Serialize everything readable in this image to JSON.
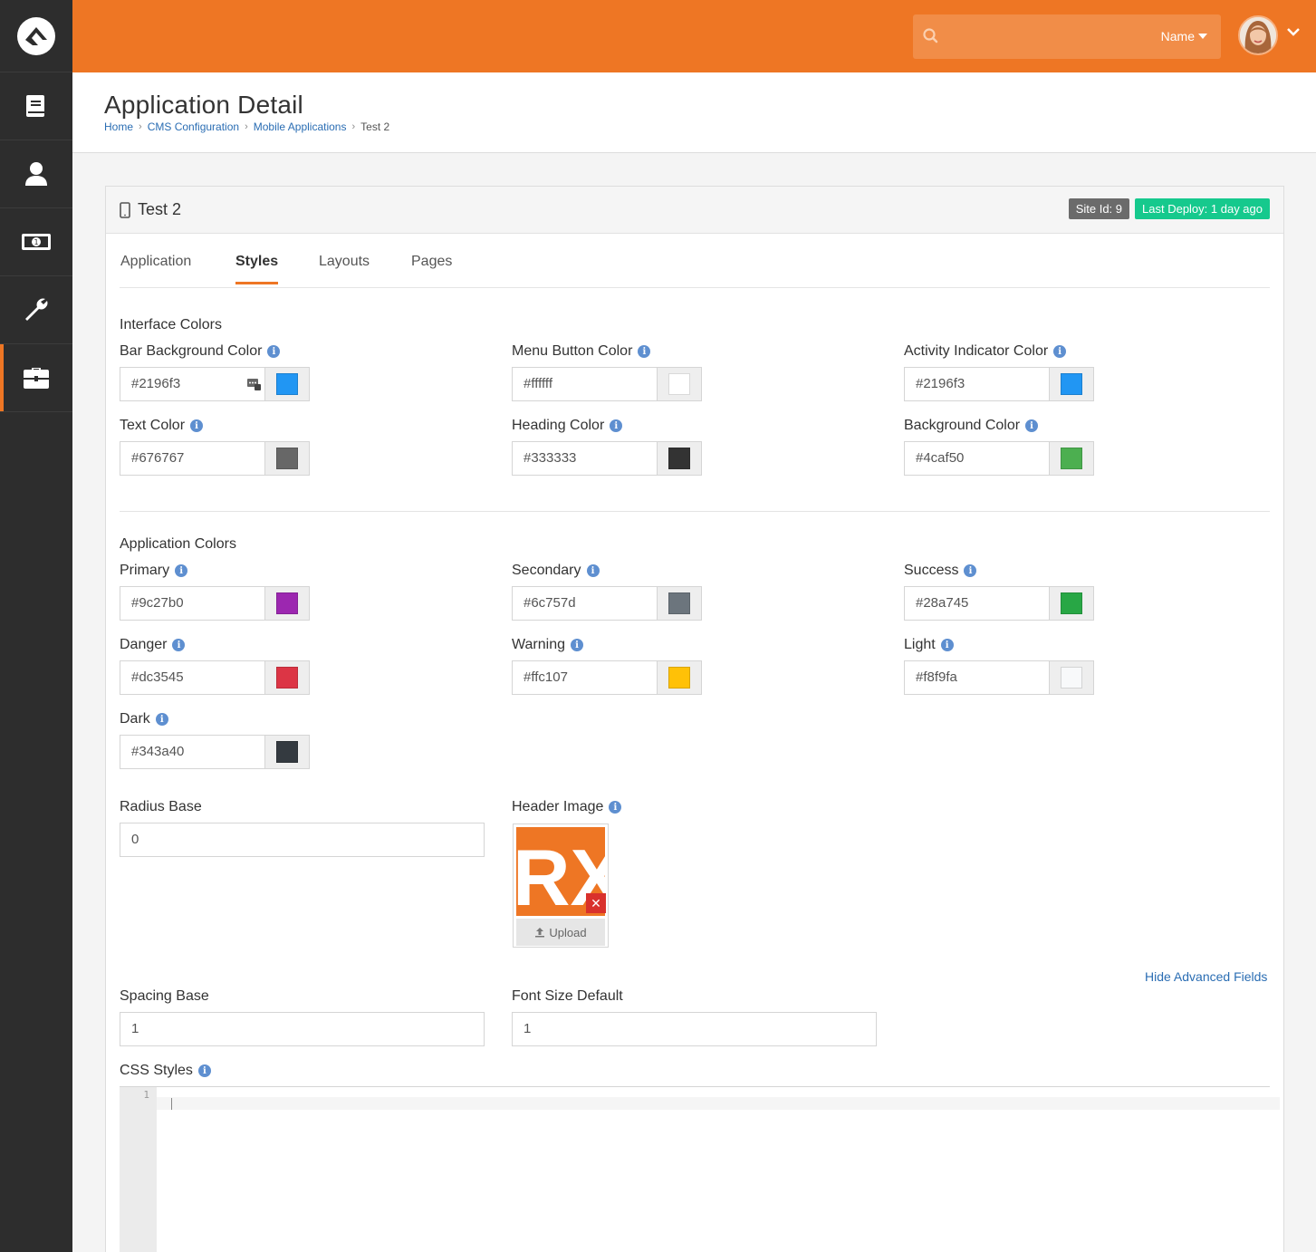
{
  "app": {
    "title": "Application Detail",
    "breadcrumb": [
      "Home",
      "CMS Configuration",
      "Mobile Applications",
      "Test 2"
    ]
  },
  "topbar": {
    "search_scope": "Name"
  },
  "panel": {
    "title": "Test 2",
    "site_id_label": "Site Id: 9",
    "deploy_label": "Last Deploy: 1 day ago"
  },
  "tabs": [
    {
      "label": "Application",
      "active": false
    },
    {
      "label": "Styles",
      "active": true
    },
    {
      "label": "Layouts",
      "active": false
    },
    {
      "label": "Pages",
      "active": false
    }
  ],
  "interface_colors": {
    "title": "Interface Colors",
    "fields": [
      {
        "label": "Bar Background Color",
        "value": "#2196f3",
        "color": "#2196f3"
      },
      {
        "label": "Menu Button Color",
        "value": "#ffffff",
        "color": "#ffffff"
      },
      {
        "label": "Activity Indicator Color",
        "value": "#2196f3",
        "color": "#2196f3"
      },
      {
        "label": "Text Color",
        "value": "#676767",
        "color": "#676767"
      },
      {
        "label": "Heading Color",
        "value": "#333333",
        "color": "#333333"
      },
      {
        "label": "Background Color",
        "value": "#4caf50",
        "color": "#4caf50"
      }
    ]
  },
  "application_colors": {
    "title": "Application Colors",
    "fields": [
      {
        "label": "Primary",
        "value": "#9c27b0",
        "color": "#9c27b0"
      },
      {
        "label": "Secondary",
        "value": "#6c757d",
        "color": "#6c757d"
      },
      {
        "label": "Success",
        "value": "#28a745",
        "color": "#28a745"
      },
      {
        "label": "Danger",
        "value": "#dc3545",
        "color": "#dc3545"
      },
      {
        "label": "Warning",
        "value": "#ffc107",
        "color": "#ffc107"
      },
      {
        "label": "Light",
        "value": "#f8f9fa",
        "color": "#f8f9fa"
      },
      {
        "label": "Dark",
        "value": "#343a40",
        "color": "#343a40"
      }
    ]
  },
  "radius_base": {
    "label": "Radius Base",
    "value": "0"
  },
  "header_image": {
    "label": "Header Image",
    "logo_text": "RX",
    "upload_label": "Upload"
  },
  "advanced_link": "Hide Advanced Fields",
  "spacing_base": {
    "label": "Spacing Base",
    "value": "1"
  },
  "font_size_default": {
    "label": "Font Size Default",
    "value": "1"
  },
  "css_styles": {
    "label": "CSS Styles",
    "line_number": "1"
  },
  "icons": {
    "logo": "rock-logo-icon",
    "sidebar": [
      "book-icon",
      "person-icon",
      "money-icon",
      "wrench-icon",
      "briefcase-icon"
    ],
    "search": "search-icon",
    "info": "info-icon",
    "mobile": "mobile-icon"
  },
  "accent_color": "#ee7624"
}
